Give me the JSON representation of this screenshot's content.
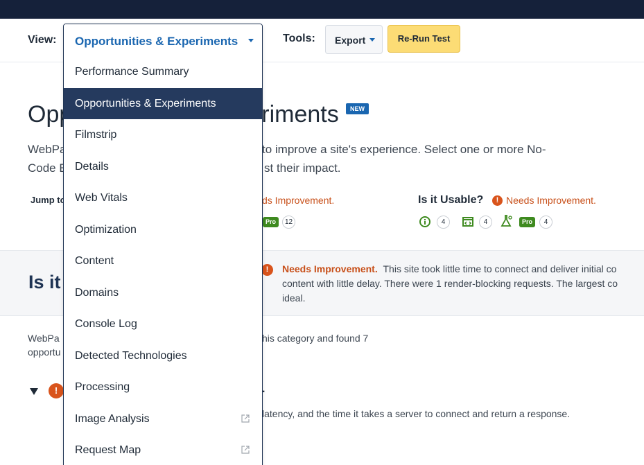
{
  "toolbar": {
    "view_label": "View:",
    "tools_label": "Tools:",
    "export_label": "Export",
    "rerun_label": "Re-Run Test"
  },
  "dropdown": {
    "selected": "Opportunities & Experiments",
    "items": [
      {
        "label": "Performance Summary",
        "external": false
      },
      {
        "label": "Opportunities & Experiments",
        "external": false,
        "selected": true
      },
      {
        "label": "Filmstrip",
        "external": false
      },
      {
        "label": "Details",
        "external": false
      },
      {
        "label": "Web Vitals",
        "external": false
      },
      {
        "label": "Optimization",
        "external": false
      },
      {
        "label": "Content",
        "external": false
      },
      {
        "label": "Domains",
        "external": false
      },
      {
        "label": "Console Log",
        "external": false
      },
      {
        "label": "Detected Technologies",
        "external": false
      },
      {
        "label": "Processing",
        "external": false
      },
      {
        "label": "Image Analysis",
        "external": true
      },
      {
        "label": "Request Map",
        "external": true
      }
    ]
  },
  "page": {
    "title_left": "Opp",
    "title_right": "riments",
    "new_badge": "NEW",
    "intro_line1_left": "WebPa",
    "intro_line1_right": "to improve a site's experience. Select one or more No-",
    "intro_line2_left": "Code E",
    "intro_line2_right": "st their impact.",
    "jump_label": "Jump to"
  },
  "summary": {
    "left_status": "ds Improvement.",
    "left_pro": "Pro",
    "left_count": "12",
    "usable_label": "Is it Usable?",
    "usable_status": "Needs Improvement.",
    "usable_counts": [
      "4",
      "4",
      "4"
    ],
    "usable_pro": "Pro",
    "warn_glyph": "!"
  },
  "section": {
    "heading": "Is it",
    "status_label": "Needs Improvement.",
    "line1": "This site took little time to connect and deliver initial co",
    "line2": "content with little delay. There were 1 render-blocking requests. The largest co",
    "line3": "ideal."
  },
  "body": {
    "line1_left": "WebPa",
    "line1_right": "his category and found 7",
    "line2_left": "opportu",
    "period": ".",
    "latency": "latency, and the time it takes a server to connect and return a response."
  },
  "colors": {
    "nav_dark": "#15213a",
    "accent_blue": "#1a66b0",
    "selected_bg": "#253a5e",
    "warning": "#d9541c",
    "rerun_yellow": "#fcdc75",
    "pro_green": "#3e8a1f"
  }
}
